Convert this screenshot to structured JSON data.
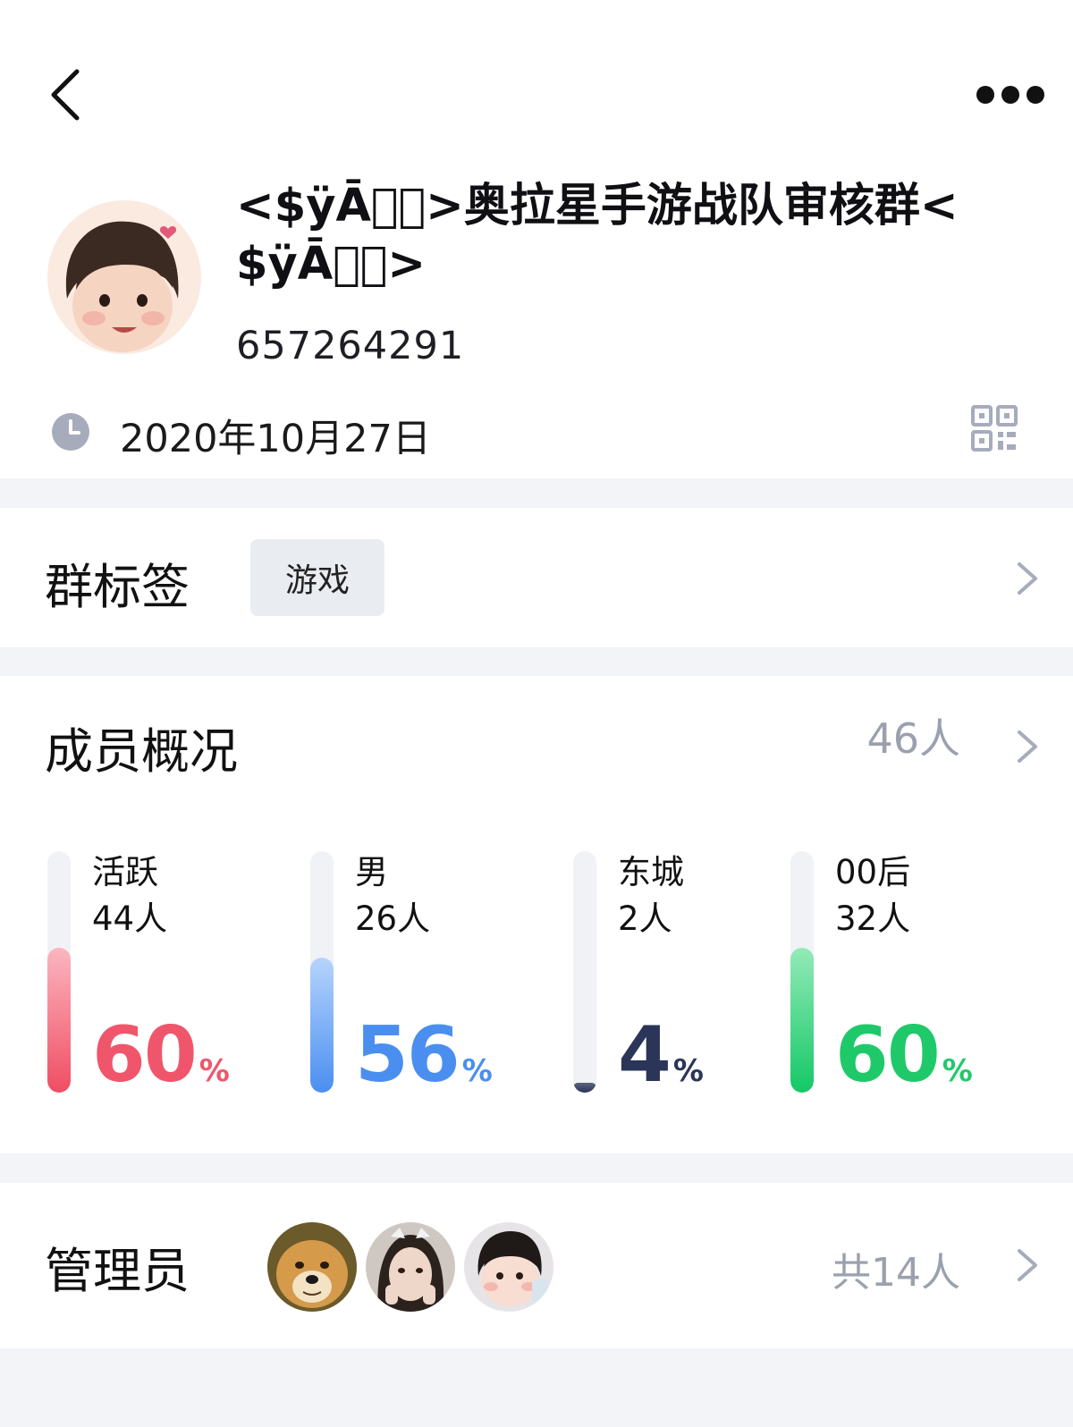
{
  "header": {
    "group_name": "<$ÿĀ\u0000\u0000>奥拉星手游战队审核群<$ÿĀ\u0000\u0000>",
    "group_id": "657264291",
    "created_date": "2020年10月27日"
  },
  "tags": {
    "title": "群标签",
    "items": [
      "游戏"
    ]
  },
  "members": {
    "title": "成员概况",
    "count": "46人",
    "stats": [
      {
        "label": "活跃",
        "count": "44人",
        "percent": "60",
        "unit": "%",
        "fraction": 0.6,
        "color": "#f0566b",
        "fill_top": "#fbb6c0",
        "fill_bottom": "#f04d63"
      },
      {
        "label": "男",
        "count": "26人",
        "percent": "56",
        "unit": "%",
        "fraction": 0.56,
        "color": "#4a8ff0",
        "fill_top": "#b6d4fd",
        "fill_bottom": "#4a8ff0"
      },
      {
        "label": "东城",
        "count": "2人",
        "percent": "4",
        "unit": "%",
        "fraction": 0.04,
        "color": "#2b3557",
        "fill_top": "#5c6480",
        "fill_bottom": "#2b3557"
      },
      {
        "label": "00后",
        "count": "32人",
        "percent": "60",
        "unit": "%",
        "fraction": 0.6,
        "color": "#1fc96a",
        "fill_top": "#93eab8",
        "fill_bottom": "#14c866"
      }
    ]
  },
  "admins": {
    "title": "管理员",
    "total": "共14人"
  }
}
